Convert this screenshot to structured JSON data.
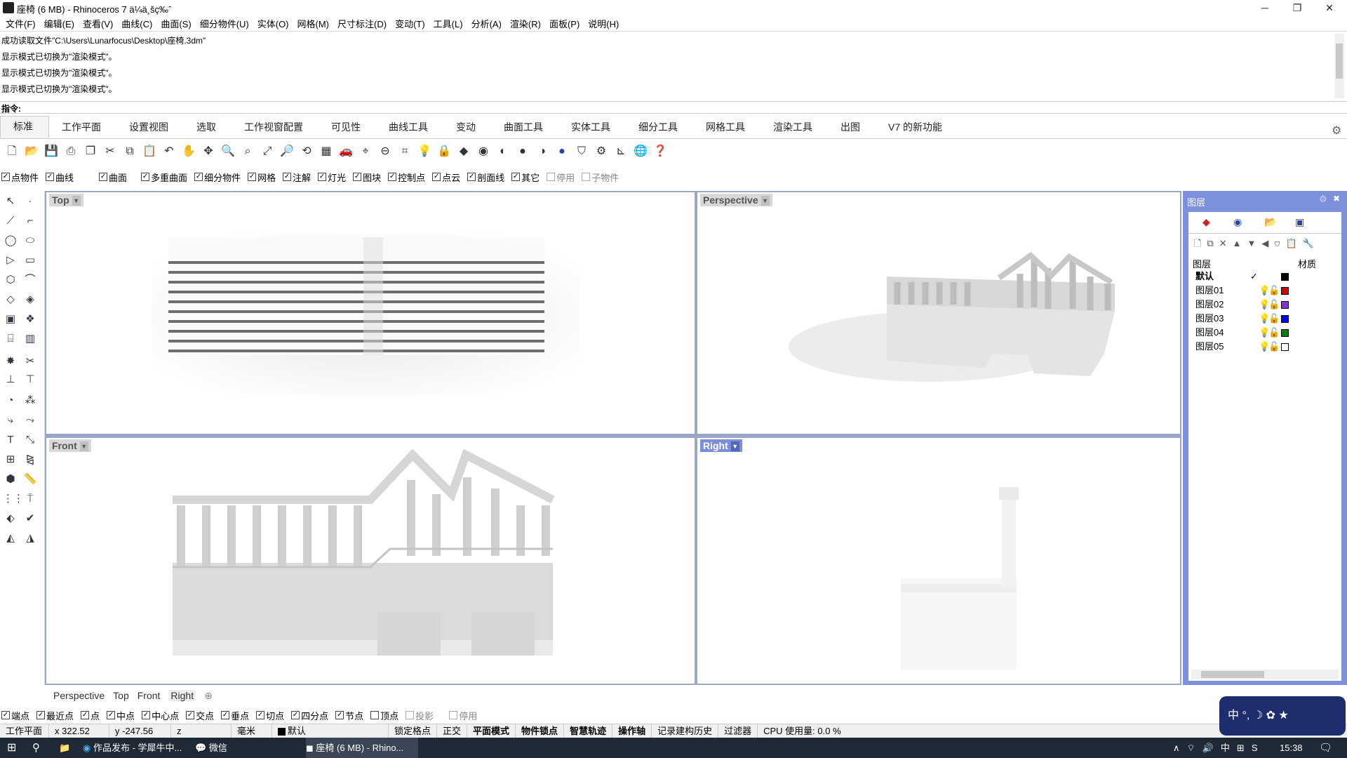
{
  "title": "座椅 (6 MB) - Rhinoceros 7 ä¼ä¸šç‰ˆ",
  "menu": [
    "文件(F)",
    "编辑(E)",
    "查看(V)",
    "曲线(C)",
    "曲面(S)",
    "细分物件(U)",
    "实体(O)",
    "网格(M)",
    "尺寸标注(D)",
    "变动(T)",
    "工具(L)",
    "分析(A)",
    "渲染(R)",
    "面板(P)",
    "说明(H)"
  ],
  "history": [
    "成功读取文件\"C:\\Users\\Lunarfocus\\Desktop\\座椅.3dm\"",
    "显示模式已切换为\"渲染模式\"。",
    "显示模式已切换为\"渲染模式\"。",
    "显示模式已切换为\"渲染模式\"。"
  ],
  "command_label": "指令:",
  "tabs": [
    "标准",
    "工作平面",
    "设置视图",
    "选取",
    "工作视窗配置",
    "可见性",
    "曲线工具",
    "变动",
    "曲面工具",
    "实体工具",
    "细分工具",
    "网格工具",
    "渲染工具",
    "出图",
    "V7 的新功能"
  ],
  "filters": [
    {
      "l": "点物件",
      "c": true
    },
    {
      "l": "曲线",
      "c": true
    },
    {
      "l": "曲面",
      "c": true
    },
    {
      "l": "多重曲面",
      "c": true
    },
    {
      "l": "细分物件",
      "c": true
    },
    {
      "l": "网格",
      "c": true
    },
    {
      "l": "注解",
      "c": true
    },
    {
      "l": "灯光",
      "c": true
    },
    {
      "l": "图块",
      "c": true
    },
    {
      "l": "控制点",
      "c": true
    },
    {
      "l": "点云",
      "c": true
    },
    {
      "l": "剖面线",
      "c": true
    },
    {
      "l": "其它",
      "c": true
    },
    {
      "l": "停用",
      "c": false
    },
    {
      "l": "子物件",
      "c": false
    }
  ],
  "viewports": {
    "top": "Top",
    "perspective": "Perspective",
    "front": "Front",
    "right": "Right"
  },
  "layers": {
    "title": "图层",
    "col_layer": "图层",
    "col_material": "材质",
    "rows": [
      {
        "name": "默认",
        "color": "#000000",
        "current": true
      },
      {
        "name": "图层01",
        "color": "#d00000"
      },
      {
        "name": "图层02",
        "color": "#8a2be2"
      },
      {
        "name": "图层03",
        "color": "#0000ff"
      },
      {
        "name": "图层04",
        "color": "#008000"
      },
      {
        "name": "图层05",
        "color": "#ffffff"
      }
    ]
  },
  "viewtabs": [
    "Perspective",
    "Top",
    "Front",
    "Right"
  ],
  "osnaps": [
    {
      "l": "端点",
      "c": true
    },
    {
      "l": "最近点",
      "c": true
    },
    {
      "l": "点",
      "c": true
    },
    {
      "l": "中点",
      "c": true
    },
    {
      "l": "中心点",
      "c": true
    },
    {
      "l": "交点",
      "c": true
    },
    {
      "l": "垂点",
      "c": true
    },
    {
      "l": "切点",
      "c": true
    },
    {
      "l": "四分点",
      "c": true
    },
    {
      "l": "节点",
      "c": true
    },
    {
      "l": "顶点",
      "c": false
    },
    {
      "l": "投影",
      "c": false
    },
    {
      "l": "停用",
      "c": false
    }
  ],
  "status": {
    "cplane": "工作平面",
    "x": "x 322.52",
    "y": "y -247.56",
    "z": "z",
    "unit": "毫米",
    "layer": "默认",
    "grid": "锁定格点",
    "ortho": "正交",
    "planar": "平面模式",
    "osnap": "物件锁点",
    "smarttrack": "智慧轨迹",
    "gumball": "操作轴",
    "history": "记录建构历史",
    "filter": "过滤器",
    "cpu": "CPU 使用量: 0.0 %"
  },
  "taskbar": {
    "app1": "作品发布 - 学犀牛中...",
    "app2": "微信",
    "app3": "座椅 (6 MB) - Rhino...",
    "time": "15:38"
  },
  "ime": "中 °, ☽ ✿ ★"
}
